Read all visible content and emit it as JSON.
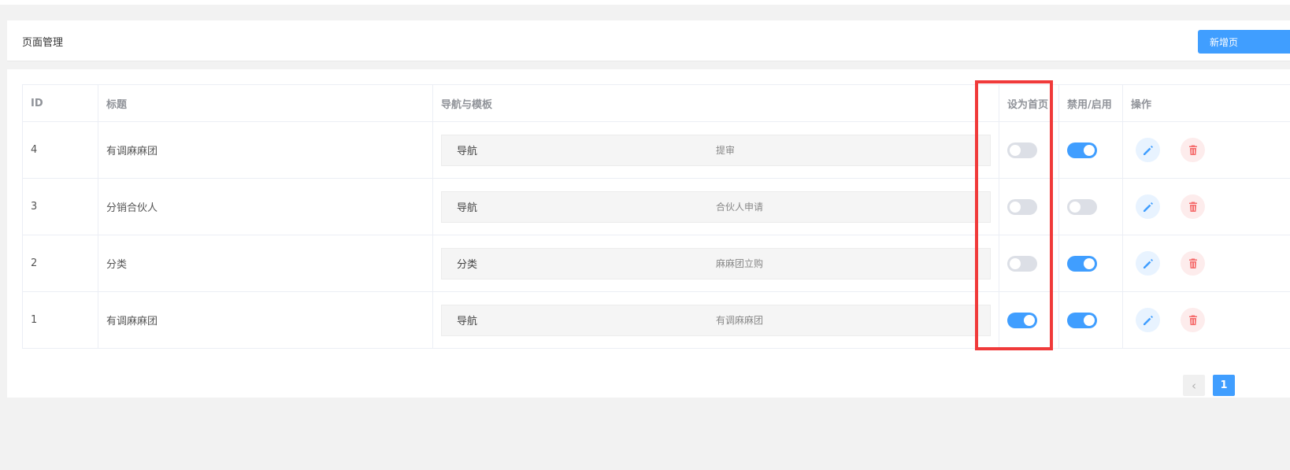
{
  "header": {
    "title": "页面管理",
    "new_button_label": "新增页"
  },
  "table": {
    "columns": [
      "ID",
      "标题",
      "导航与模板",
      "设为首页",
      "禁用/启用",
      "操作"
    ],
    "rows": [
      {
        "id": "4",
        "title": "有调麻麻团",
        "nav_type": "导航",
        "template": "提审",
        "set_home": false,
        "enabled": true
      },
      {
        "id": "3",
        "title": "分销合伙人",
        "nav_type": "导航",
        "template": "合伙人申请",
        "set_home": false,
        "enabled": false
      },
      {
        "id": "2",
        "title": "分类",
        "nav_type": "分类",
        "template": "麻麻团立购",
        "set_home": false,
        "enabled": true
      },
      {
        "id": "1",
        "title": "有调麻麻团",
        "nav_type": "导航",
        "template": "有调麻麻团",
        "set_home": true,
        "enabled": true
      }
    ]
  },
  "pagination": {
    "prev_label": "‹",
    "current_page": "1"
  },
  "icons": {
    "edit": "pencil-icon",
    "delete": "trash-icon"
  },
  "colors": {
    "accent": "#409eff",
    "danger": "#f56c6c",
    "highlight": "#f03a3a"
  }
}
